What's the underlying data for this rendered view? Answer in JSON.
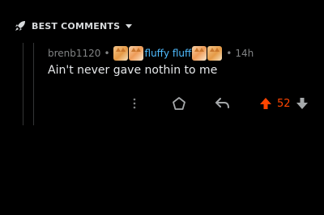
{
  "section": {
    "title": "BEST COMMENTS",
    "icon": "rocket-icon",
    "sort_icon": "caret-down-icon"
  },
  "comment": {
    "username": "brenb1120",
    "separator": "•",
    "flair_text": "fluffy fluff",
    "time_ago": "14h",
    "body": "Ain't never gave nothin to me",
    "score": "52",
    "vote_state": "upvoted"
  },
  "actions": {
    "more_icon": "more-vertical-icon",
    "award_icon": "award-icon",
    "reply_icon": "reply-icon",
    "upvote_icon": "upvote-arrow-icon",
    "downvote_icon": "downvote-arrow-icon"
  },
  "colors": {
    "background": "#000000",
    "text": "#e6e8ea",
    "muted": "#818384",
    "flair": "#4fbcff",
    "upvote": "#ff4500",
    "thread_line": "#343536"
  }
}
